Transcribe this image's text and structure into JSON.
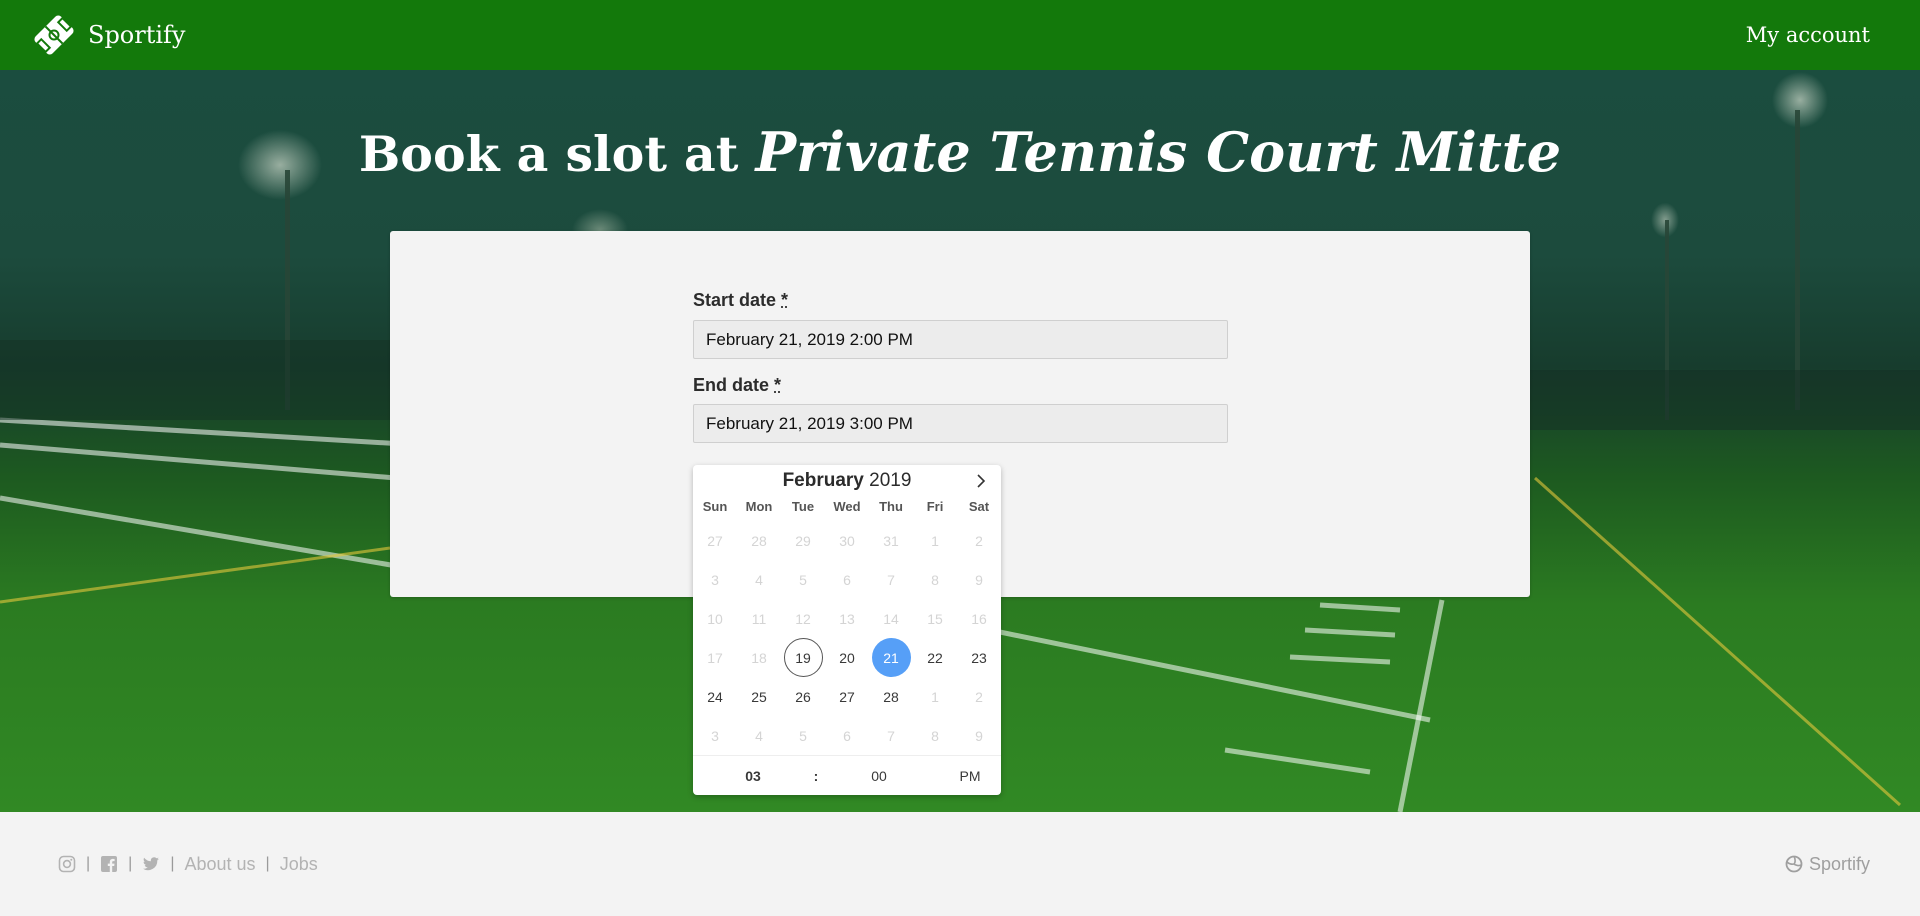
{
  "header": {
    "brand_name": "Sportify",
    "brand_icon": "sportify-logo-icon",
    "account_link": "My account",
    "bg_color": "#13790b"
  },
  "hero": {
    "title_prefix": "Book a slot at",
    "venue_name": "Private Tennis Court Mitte"
  },
  "form": {
    "start_date": {
      "label": "Start date",
      "required_mark": "*",
      "value": "February 21, 2019 2:00 PM"
    },
    "end_date": {
      "label": "End date",
      "required_mark": "*",
      "value": "February 21, 2019 3:00 PM"
    }
  },
  "datepicker": {
    "month": "February",
    "year": "2019",
    "next_icon": "chevron-right-icon",
    "weekdays": [
      "Sun",
      "Mon",
      "Tue",
      "Wed",
      "Thu",
      "Fri",
      "Sat"
    ],
    "days": [
      {
        "n": "27",
        "state": "disabled"
      },
      {
        "n": "28",
        "state": "disabled"
      },
      {
        "n": "29",
        "state": "disabled"
      },
      {
        "n": "30",
        "state": "disabled"
      },
      {
        "n": "31",
        "state": "disabled"
      },
      {
        "n": "1",
        "state": "disabled"
      },
      {
        "n": "2",
        "state": "disabled"
      },
      {
        "n": "3",
        "state": "disabled"
      },
      {
        "n": "4",
        "state": "disabled"
      },
      {
        "n": "5",
        "state": "disabled"
      },
      {
        "n": "6",
        "state": "disabled"
      },
      {
        "n": "7",
        "state": "disabled"
      },
      {
        "n": "8",
        "state": "disabled"
      },
      {
        "n": "9",
        "state": "disabled"
      },
      {
        "n": "10",
        "state": "disabled"
      },
      {
        "n": "11",
        "state": "disabled"
      },
      {
        "n": "12",
        "state": "disabled"
      },
      {
        "n": "13",
        "state": "disabled"
      },
      {
        "n": "14",
        "state": "disabled"
      },
      {
        "n": "15",
        "state": "disabled"
      },
      {
        "n": "16",
        "state": "disabled"
      },
      {
        "n": "17",
        "state": "disabled"
      },
      {
        "n": "18",
        "state": "disabled"
      },
      {
        "n": "19",
        "state": "today"
      },
      {
        "n": "20",
        "state": "normal"
      },
      {
        "n": "21",
        "state": "selected"
      },
      {
        "n": "22",
        "state": "normal"
      },
      {
        "n": "23",
        "state": "normal"
      },
      {
        "n": "24",
        "state": "normal"
      },
      {
        "n": "25",
        "state": "normal"
      },
      {
        "n": "26",
        "state": "normal"
      },
      {
        "n": "27",
        "state": "normal"
      },
      {
        "n": "28",
        "state": "normal"
      },
      {
        "n": "1",
        "state": "disabled"
      },
      {
        "n": "2",
        "state": "disabled"
      },
      {
        "n": "3",
        "state": "disabled"
      },
      {
        "n": "4",
        "state": "disabled"
      },
      {
        "n": "5",
        "state": "disabled"
      },
      {
        "n": "6",
        "state": "disabled"
      },
      {
        "n": "7",
        "state": "disabled"
      },
      {
        "n": "8",
        "state": "disabled"
      },
      {
        "n": "9",
        "state": "disabled"
      }
    ],
    "time": {
      "hour": "03",
      "separator": ":",
      "minute": "00",
      "ampm": "PM"
    },
    "selected_color": "#569ff7"
  },
  "footer": {
    "social_icons": [
      "instagram-icon",
      "facebook-icon",
      "twitter-icon"
    ],
    "separator": "|",
    "links": [
      "About us",
      "Jobs"
    ],
    "brand_name": "Sportify",
    "brand_icon": "sportify-ball-icon"
  }
}
